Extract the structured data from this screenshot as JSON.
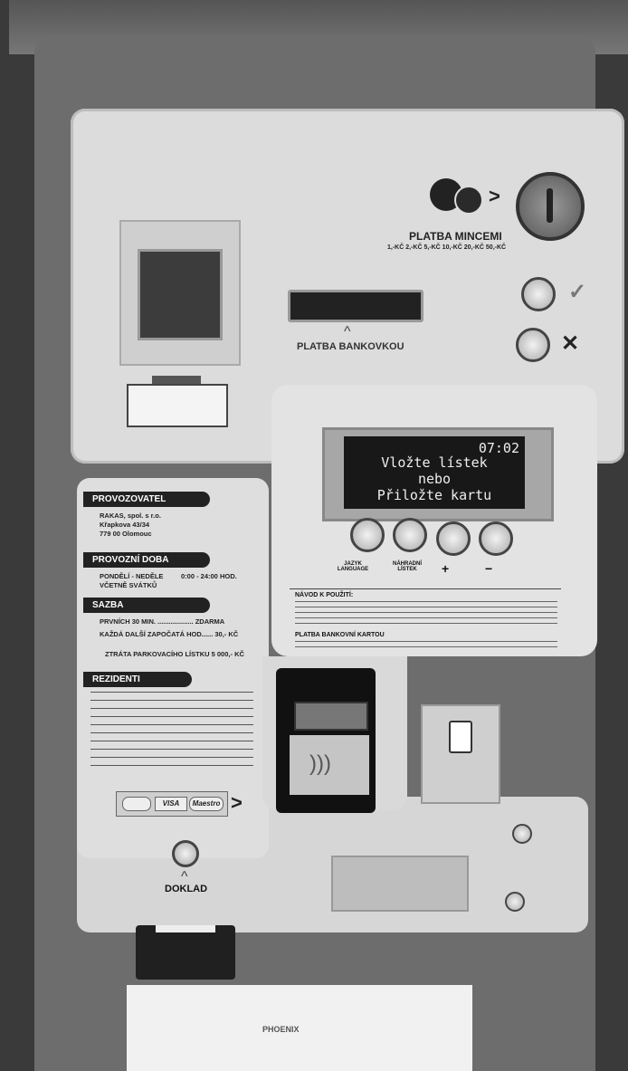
{
  "coins": {
    "title": "PLATBA MINCEMI",
    "values": "1,-KČ 2,-KČ 5,-KČ 10,-KČ 20,-KČ 50,-KČ"
  },
  "banknote": {
    "label": "PLATBA BANKOVKOU"
  },
  "display": {
    "time": "07:02",
    "line1": "Vložte lístek",
    "line2": "nebo",
    "line3": "Přiložte kartu"
  },
  "keypad": {
    "language": "JAZYK LANGUAGE",
    "lost_ticket": "NÁHRADNÍ LÍSTEK",
    "plus": "+",
    "minus": "−"
  },
  "instructions": {
    "title": "NÁVOD K POUŽITÍ:",
    "card_title": "PLATBA BANKOVNÍ KARTOU"
  },
  "operator": {
    "header": "PROVOZOVATEL",
    "line1": "RAKAS, spol. s r.o.",
    "line2": "Křapkova 43/34",
    "line3": "779 00 Olomouc"
  },
  "hours": {
    "header": "PROVOZNÍ DOBA",
    "days": "PONDĚLÍ - NEDĚLE",
    "time": "0:00 - 24:00 HOD.",
    "holidays": "VČETNĚ SVÁTKŮ"
  },
  "rates": {
    "header": "SAZBA",
    "first": "PRVNÍCH 30 MIN. ................... ZDARMA",
    "next": "KAŽDÁ DALŠÍ ZAPOČATÁ HOD...... 30,- KČ",
    "lost": "ZTRÁTA PARKOVACÍHO LÍSTKU 5 000,- KČ"
  },
  "residents": {
    "header": "REZIDENTI"
  },
  "card_logos": [
    "VISA",
    "Maestro"
  ],
  "receipt": {
    "label": "DOKLAD"
  },
  "footer": {
    "brand": "PHOENIX"
  }
}
